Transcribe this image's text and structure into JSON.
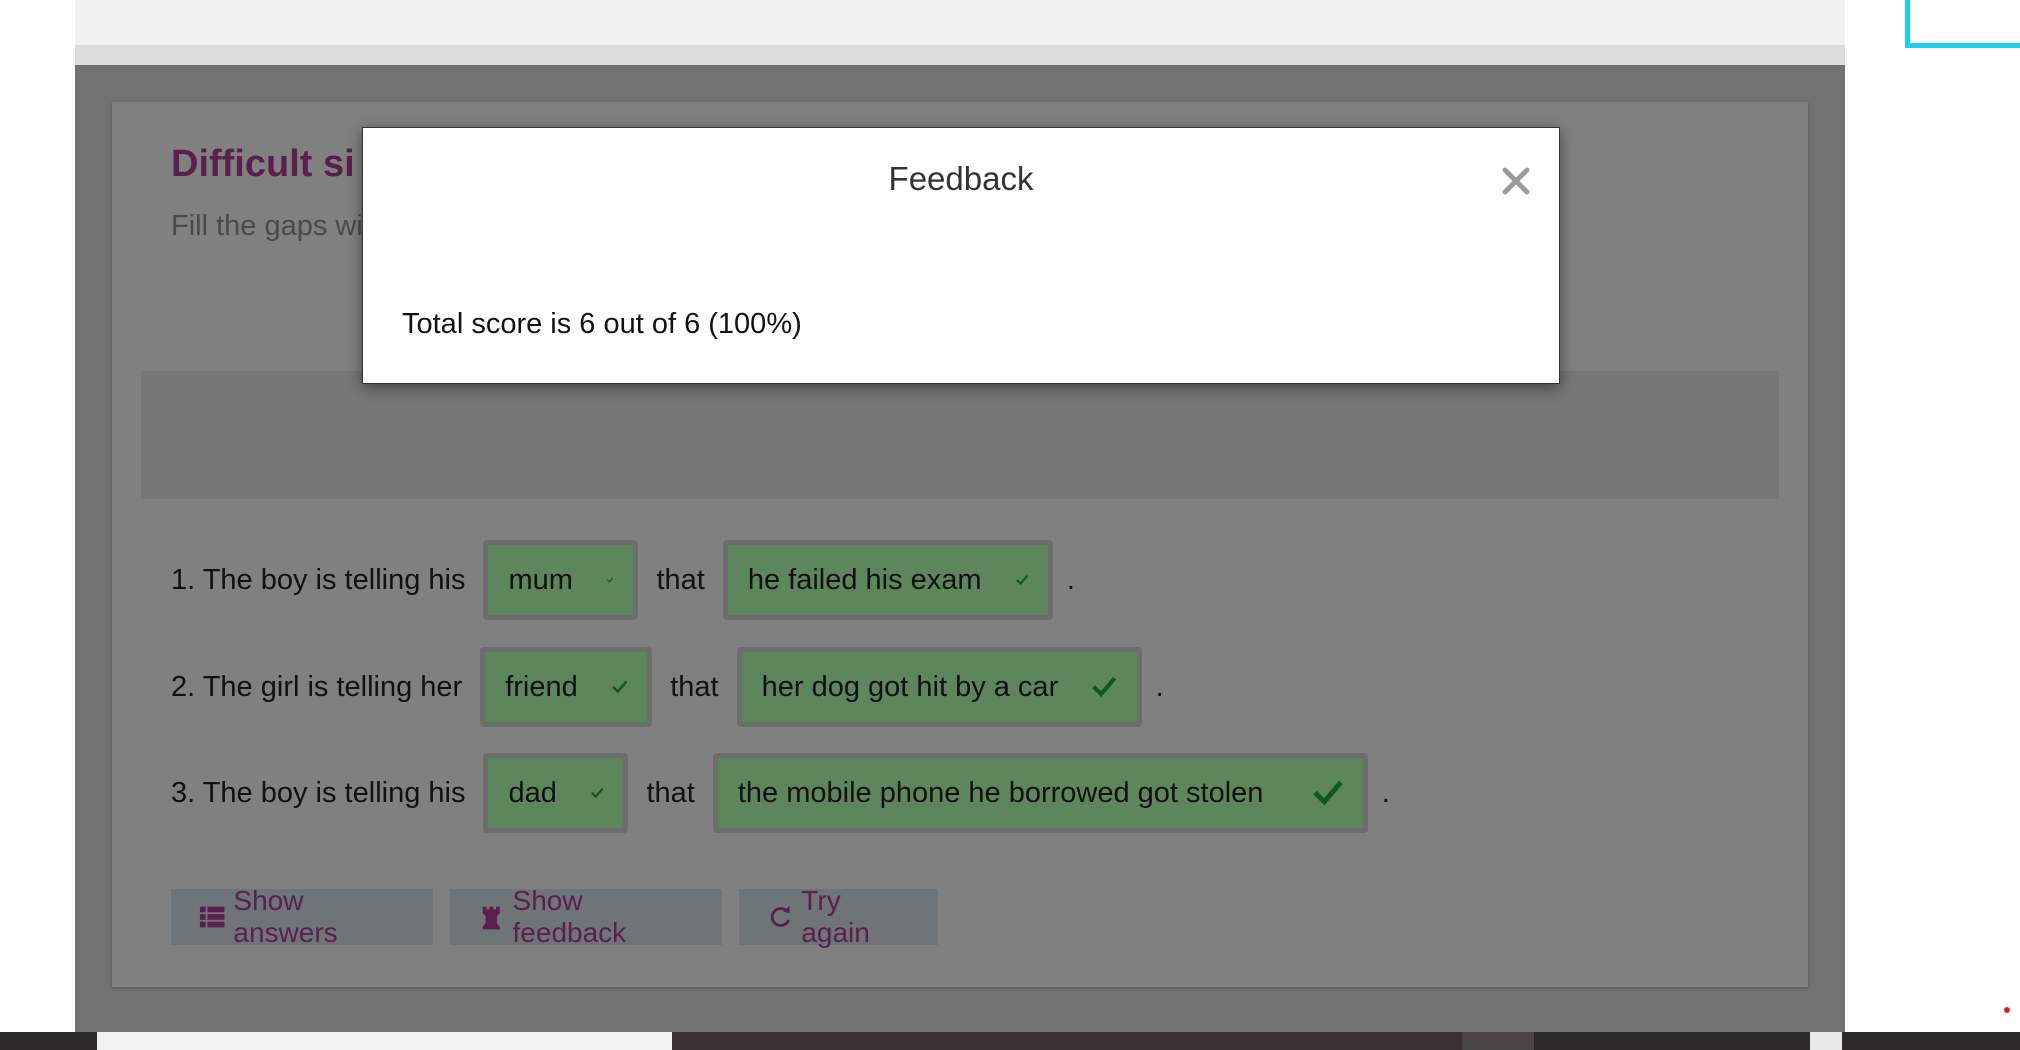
{
  "activity": {
    "title": "Difficult si",
    "description": "Fill the gaps wi"
  },
  "questions": [
    {
      "prompt": "1. The boy is telling his",
      "answer1": "mum",
      "connector": "that",
      "answer2": "he failed his exam",
      "end": "."
    },
    {
      "prompt": "2. The girl is telling her",
      "answer1": "friend",
      "connector": "that",
      "answer2": "her dog got hit by a car",
      "end": "."
    },
    {
      "prompt": "3. The boy is telling his",
      "answer1": "dad",
      "connector": "that",
      "answer2": "the mobile phone he borrowed got stolen",
      "end": "."
    }
  ],
  "buttons": {
    "show_answers": "Show answers",
    "show_feedback": "Show feedback",
    "try_again": "Try again"
  },
  "modal": {
    "title": "Feedback",
    "score_text": "Total score is 6 out of 6 (100%)"
  },
  "colors": {
    "title_purple": "#5a1f4b",
    "correct_green": "#5d865d",
    "check_dark_green": "#0e5a1c",
    "accent_cyan": "#1ad0f0"
  },
  "icons": {
    "correct": "check-icon",
    "show_answers": "list-icon",
    "show_feedback": "rook-icon",
    "try_again": "refresh-icon",
    "close": "close-icon"
  }
}
